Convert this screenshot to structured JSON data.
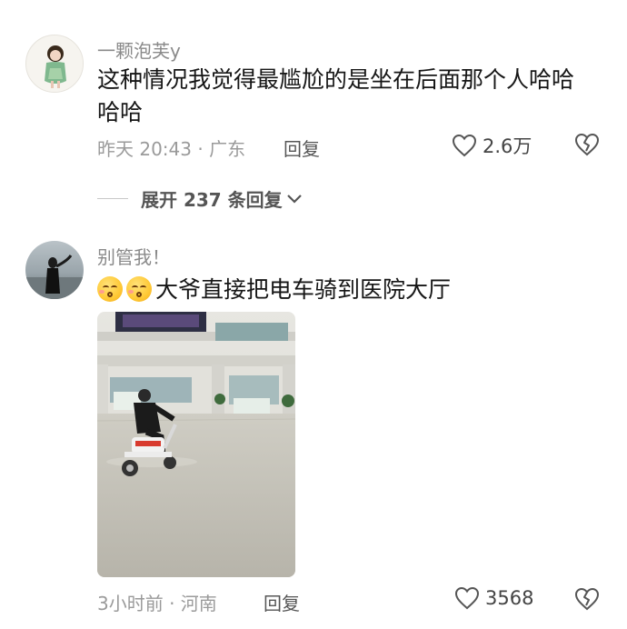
{
  "comments": [
    {
      "username": "一颗泡芙y",
      "content": "这种情况我觉得最尴尬的是坐在后面那个人哈哈哈哈",
      "time_location": "昨天 20:43 · 广东",
      "reply_label": "回复",
      "like_count": "2.6万"
    },
    {
      "username": "别管我！",
      "content_emojis": [
        "kissing-face-emoji",
        "kissing-face-emoji"
      ],
      "content": "大爷直接把电车骑到医院大厅",
      "time_location": "3小时前 · 河南",
      "reply_label": "回复",
      "like_count": "3568"
    }
  ],
  "expand_replies": {
    "label": "展开 237 条回复"
  },
  "colors": {
    "text_primary": "#161616",
    "text_secondary": "#9a9a9a",
    "username": "#8a8a8a",
    "reply": "#555555"
  }
}
